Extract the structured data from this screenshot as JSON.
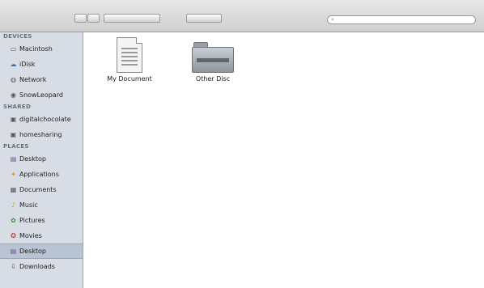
{
  "toolbar": {
    "search_placeholder": ""
  },
  "sidebar": {
    "sections": [
      {
        "heading": "DEVICES",
        "items": [
          {
            "label": "Macintosh",
            "icon": "hard-drive-icon"
          },
          {
            "label": "iDisk",
            "icon": "cloud-disk-icon"
          },
          {
            "label": "Network",
            "icon": "network-icon"
          },
          {
            "label": "SnowLeopard",
            "icon": "disk-icon"
          }
        ]
      },
      {
        "heading": "SHARED",
        "items": [
          {
            "label": "digitalchocolate",
            "icon": "computer-icon"
          },
          {
            "label": "homesharing",
            "icon": "computer-icon"
          }
        ]
      },
      {
        "heading": "PLACES",
        "items": [
          {
            "label": "Desktop",
            "icon": "desktop-icon"
          },
          {
            "label": "Applications",
            "icon": "applications-icon"
          },
          {
            "label": "Documents",
            "icon": "documents-icon"
          },
          {
            "label": "Music",
            "icon": "music-icon"
          },
          {
            "label": "Pictures",
            "icon": "pictures-icon"
          },
          {
            "label": "Movies",
            "icon": "movies-icon"
          },
          {
            "label": "Desktop",
            "icon": "desktop-icon",
            "selected": true
          },
          {
            "label": "Downloads",
            "icon": "downloads-icon"
          }
        ]
      }
    ]
  },
  "content": {
    "files": [
      {
        "label": "My Document",
        "icon": "document-icon"
      },
      {
        "label": "Other Disc",
        "icon": "folder-icon"
      }
    ]
  }
}
